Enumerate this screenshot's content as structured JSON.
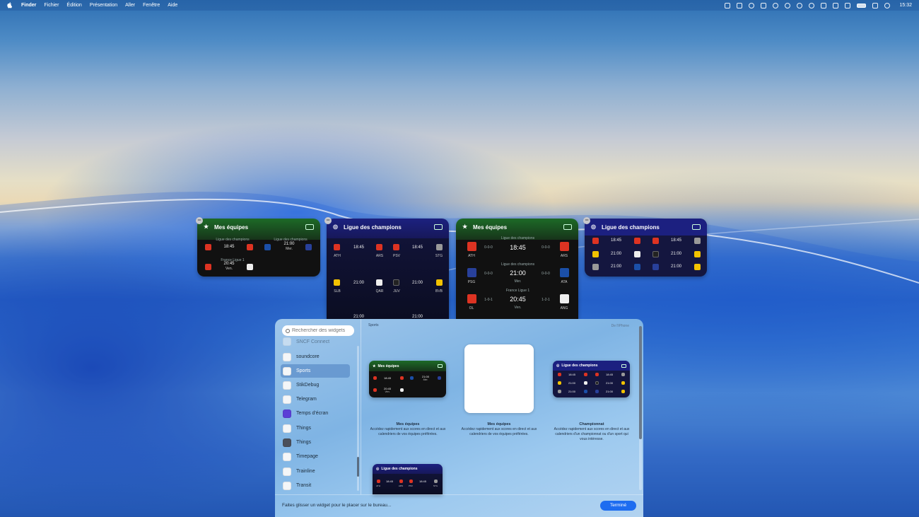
{
  "menubar": {
    "menus": [
      "Finder",
      "Fichier",
      "Édition",
      "Présentation",
      "Aller",
      "Fenêtre",
      "Aide"
    ],
    "time": "15:32"
  },
  "desktop_widgets": {
    "w1": {
      "title": "Mes équipes",
      "match1": {
        "league": "Ligue des champions",
        "time": "18:45"
      },
      "match2": {
        "league": "Ligue des champions",
        "time": "21:00",
        "day": "Mer."
      },
      "match3": {
        "league": "France Ligue 1",
        "time": "20:45",
        "day": "Ven."
      }
    },
    "w2": {
      "title": "Ligue des champions",
      "rows": [
        {
          "home": "ATH",
          "time": "18:45",
          "away": "ARS"
        },
        {
          "home": "PSV",
          "time": "18:45",
          "away": "STG"
        },
        {
          "home": "SLB",
          "time": "21:00",
          "away": "QAR"
        },
        {
          "home": "JUV",
          "time": "21:00",
          "away": "BVB"
        },
        {
          "time": "21:00"
        },
        {
          "time": "21:00"
        }
      ]
    },
    "w3": {
      "title": "Mes équipes",
      "m1": {
        "league": "Ligue des champions",
        "home": "ATH",
        "away": "ARS",
        "time": "18:45",
        "form_home": "0-0-0",
        "form_away": "0-0-0"
      },
      "m2": {
        "league": "Ligue des champions",
        "home": "PSG",
        "away": "ATA",
        "time": "21:00",
        "day": "Mer.",
        "form_home": "0-0-0",
        "form_away": "0-0-0"
      },
      "m3": {
        "league": "France Ligue 1",
        "home": "OL",
        "away": "ANG",
        "time": "20:45",
        "day": "Ven.",
        "form_home": "1-0-1",
        "form_away": "1-2-1"
      }
    },
    "w4": {
      "title": "Ligue des champions",
      "times": [
        "18:45",
        "18:45",
        "21:00",
        "21:00",
        "21:00",
        "21:00"
      ]
    }
  },
  "panel": {
    "search_placeholder": "Rechercher des widgets",
    "apps": [
      {
        "label": "SNCF Connect"
      },
      {
        "label": "soundcore"
      },
      {
        "label": "Sports"
      },
      {
        "label": "StikDebug"
      },
      {
        "label": "Telegram"
      },
      {
        "label": "Temps d'écran"
      },
      {
        "label": "Things"
      },
      {
        "label": "Things"
      },
      {
        "label": "Timepage"
      },
      {
        "label": "Trainline"
      },
      {
        "label": "Transit"
      }
    ],
    "section_title": "Sports",
    "section_source": "De l'iPhone",
    "previews": [
      {
        "title": "Mes équipes",
        "desc": "Accédez rapidement aux scores en direct et aux calendriers de vos équipes préférées.",
        "card_title": "Mes équipes",
        "times": [
          "18:45",
          "21:00",
          "Mer.",
          "20:45",
          "Ven."
        ]
      },
      {
        "title": "Mes équipes",
        "desc": "Accédez rapidement aux scores en direct et aux calendriers de vos équipes préférées."
      },
      {
        "title": "Championnat",
        "desc": "Accédez rapidement aux scores en direct et aux calendriers d'un championnat ou d'un sport qui vous intéresse.",
        "card_title": "Ligue des champions",
        "times": [
          "18:45",
          "18:45",
          "21:00",
          "21:00",
          "21:00",
          "21:00"
        ]
      }
    ],
    "preview4": {
      "card_title": "Ligue des champions",
      "times": [
        "18:45",
        "18:45"
      ],
      "abbrs": [
        "ATH",
        "ARS",
        "PSV",
        "STG"
      ]
    },
    "hint": "Faites glisser un widget pour le placer sur le bureau...",
    "done_label": "Terminé"
  }
}
